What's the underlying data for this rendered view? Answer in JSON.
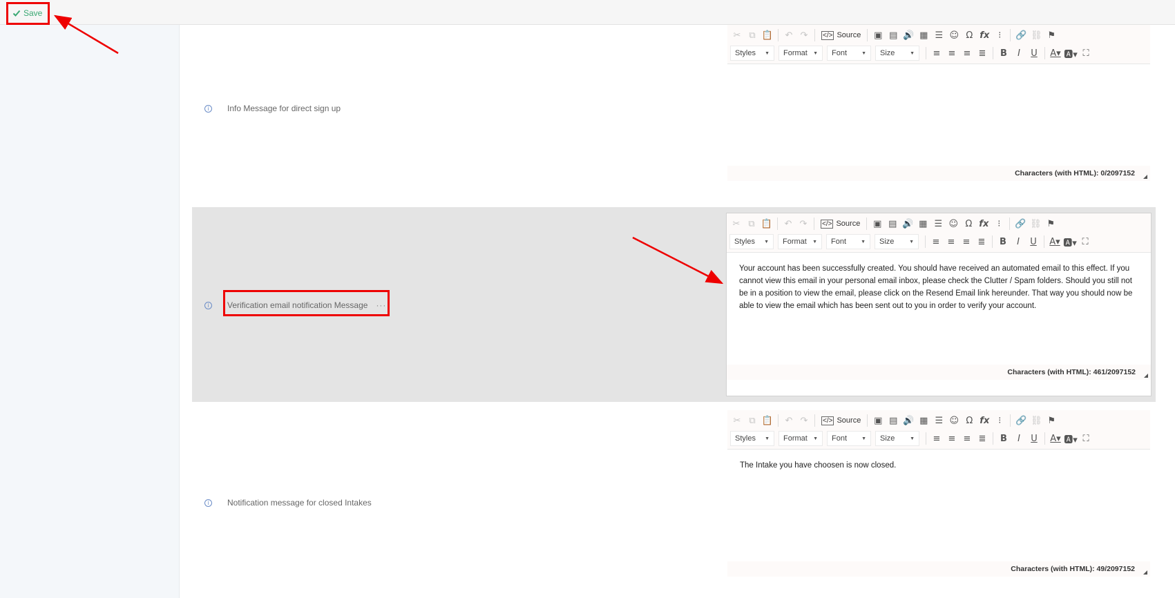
{
  "topbar": {
    "save_label": "Save"
  },
  "toolbar": {
    "source_label": "Source",
    "combos": [
      "Styles",
      "Format",
      "Font",
      "Size"
    ]
  },
  "rows": [
    {
      "label": "Info Message for direct sign up",
      "content": "",
      "counter": "Characters (with HTML): 0/2097152"
    },
    {
      "label": "Verification email notification Message",
      "dots": "···",
      "content": "Your  account has been successfully created. You should have received an automated email to this effect.  If you cannot view this email in your personal email inbox, please check the Clutter / Spam folders.  Should you still not be in a position to view the email, please click on the Resend Email link hereunder.  That way you should now be able to view the email which has been sent out to you in order to verify your account.",
      "counter": "Characters (with HTML): 461/2097152"
    },
    {
      "label": "Notification message for closed Intakes",
      "content": "The Intake you have choosen is now closed.",
      "counter": "Characters (with HTML): 49/2097152"
    }
  ],
  "icons": {
    "save": "check-icon",
    "info": "info-icon",
    "toolbar_row1": [
      "cut-icon",
      "copy-icon",
      "paste-icon",
      "undo-icon",
      "redo-icon",
      "source-icon",
      "image-icon",
      "image2-icon",
      "audio-icon",
      "table-icon",
      "horizontal-rule-icon",
      "smiley-icon",
      "special-char-icon",
      "formula-icon",
      "placeholder-icon",
      "link-icon",
      "unlink-icon",
      "anchor-icon"
    ],
    "toolbar_row2": [
      "align-left-icon",
      "align-center-icon",
      "align-right-icon",
      "justify-icon",
      "bold-icon",
      "italic-icon",
      "underline-icon",
      "text-color-icon",
      "bg-color-icon",
      "maximize-icon"
    ]
  },
  "colors": {
    "save": "#3aa873",
    "annotation": "#e00000",
    "info": "#6a8cc7",
    "highlight_row": "#e4e4e4"
  }
}
